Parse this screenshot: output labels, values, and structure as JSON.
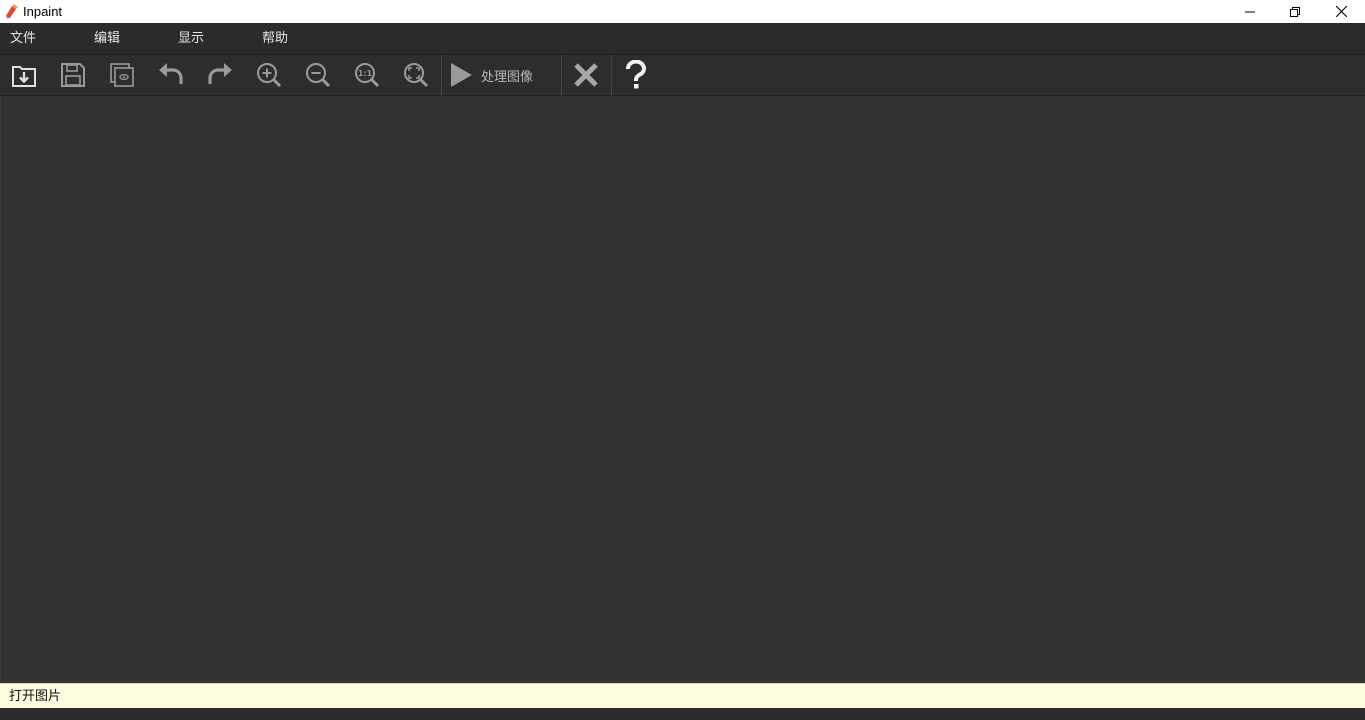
{
  "window": {
    "title": "Inpaint",
    "controls": {
      "minimize_icon": "minimize-icon",
      "restore_icon": "restore-icon",
      "close_icon": "close-icon"
    }
  },
  "menu": {
    "items": [
      {
        "label": "文件"
      },
      {
        "label": "编辑"
      },
      {
        "label": "显示"
      },
      {
        "label": "帮助"
      }
    ]
  },
  "toolbar": {
    "buttons": [
      {
        "icon": "open-file-icon"
      },
      {
        "icon": "save-icon"
      },
      {
        "icon": "preview-icon"
      },
      {
        "icon": "undo-icon"
      },
      {
        "icon": "redo-icon"
      },
      {
        "icon": "zoom-in-icon"
      },
      {
        "icon": "zoom-out-icon"
      },
      {
        "icon": "zoom-actual-size-icon"
      },
      {
        "icon": "zoom-fit-icon"
      }
    ],
    "process_label": "处理图像",
    "zoom_actual_text": "1:1",
    "cancel_icon": "x-icon",
    "help_icon": "question-icon"
  },
  "status": {
    "text": "打开图片"
  },
  "colors": {
    "background": "#2b2b2b",
    "canvas": "#323232",
    "statusbar": "#fdfbe0",
    "icon": "#c0c0c0"
  }
}
